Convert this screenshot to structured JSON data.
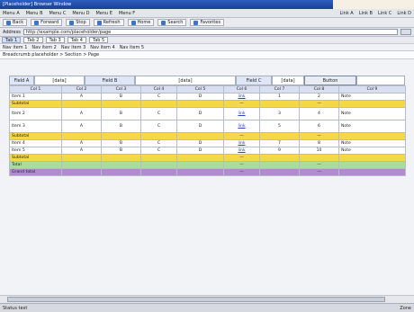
{
  "window": {
    "title": "[Placeholder] Browser Window"
  },
  "menubar": {
    "items": [
      "Menu A",
      "Menu B",
      "Menu C",
      "Menu D",
      "Menu E",
      "Menu F"
    ],
    "right_items": [
      "Link A",
      "Link B",
      "Link C",
      "Link D"
    ]
  },
  "toolbar": {
    "buttons": [
      "Back",
      "Forward",
      "Stop",
      "Refresh",
      "Home",
      "Search",
      "Favorites"
    ]
  },
  "address": {
    "label": "Address",
    "value": "http://example.com/placeholder/page"
  },
  "tabs": {
    "items": [
      "Tab 1",
      "Tab 2",
      "Tab 3",
      "Tab 4",
      "Tab 5"
    ]
  },
  "subnav": {
    "items": [
      "Nav item 1",
      "Nav item 2",
      "Nav item 3",
      "Nav item 4",
      "Nav item 5"
    ]
  },
  "breadcrumb": "Breadcrumb placeholder > Section > Page",
  "form": {
    "label1": "Field A",
    "value1": "[data]",
    "label2": "Field B",
    "value2": "[data]",
    "label3": "Field C",
    "value3": "[data]",
    "button": "Button"
  },
  "table": {
    "headers": [
      "Col 1",
      "Col 2",
      "Col 3",
      "Col 4",
      "Col 5",
      "Col 6",
      "Col 7",
      "Col 8",
      "Col 9"
    ],
    "rows": [
      {
        "kind": "row",
        "cells": [
          "Item 1",
          "A",
          "B",
          "C",
          "D",
          "link",
          "1",
          "2",
          "Note"
        ]
      },
      {
        "kind": "yellow",
        "cells": [
          "Subtotal",
          "",
          "",
          "",
          "",
          "—",
          "",
          "—",
          ""
        ]
      },
      {
        "kind": "row tall",
        "cells": [
          "Item 2",
          "A",
          "B",
          "C",
          "D",
          "link",
          "3",
          "4",
          "Note"
        ]
      },
      {
        "kind": "row tall",
        "cells": [
          "Item 3",
          "A",
          "B",
          "C",
          "D",
          "link",
          "5",
          "6",
          "Note"
        ]
      },
      {
        "kind": "yellow",
        "cells": [
          "Subtotal",
          "",
          "",
          "",
          "",
          "—",
          "",
          "—",
          ""
        ]
      },
      {
        "kind": "row",
        "cells": [
          "Item 4",
          "A",
          "B",
          "C",
          "D",
          "link",
          "7",
          "8",
          "Note"
        ]
      },
      {
        "kind": "row",
        "cells": [
          "Item 5",
          "A",
          "B",
          "C",
          "D",
          "link",
          "9",
          "10",
          "Note"
        ]
      },
      {
        "kind": "yellow",
        "cells": [
          "Subtotal",
          "",
          "",
          "",
          "",
          "—",
          "",
          "",
          ""
        ]
      },
      {
        "kind": "green",
        "cells": [
          "Total",
          "",
          "",
          "",
          "",
          "—",
          "",
          "—",
          ""
        ]
      },
      {
        "kind": "purple",
        "cells": [
          "Grand total",
          "",
          "",
          "",
          "",
          "—",
          "",
          "—",
          ""
        ]
      }
    ]
  },
  "status": {
    "left": "Status text",
    "right": "Zone"
  }
}
